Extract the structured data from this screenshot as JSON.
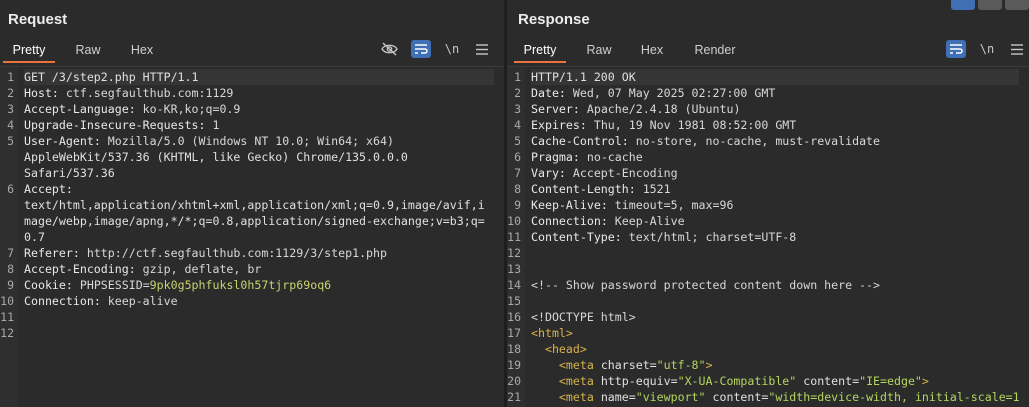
{
  "request": {
    "title": "Request",
    "tabs": [
      {
        "label": "Pretty",
        "active": true
      },
      {
        "label": "Raw",
        "active": false
      },
      {
        "label": "Hex",
        "active": false
      }
    ],
    "toolbar": {
      "wrap_label": "\\n"
    },
    "lines": [
      {
        "n": "1",
        "t": "GET /3/step2.php HTTP/1.1"
      },
      {
        "n": "2",
        "k": "Host",
        "v": "ctf.segfaulthub.com:1129"
      },
      {
        "n": "3",
        "k": "Accept-Language",
        "v": "ko-KR,ko;q=0.9"
      },
      {
        "n": "4",
        "k": "Upgrade-Insecure-Requests",
        "v": "1"
      },
      {
        "n": "5",
        "k": "User-Agent",
        "v": "Mozilla/5.0 (Windows NT 10.0; Win64; x64)"
      },
      {
        "n": "",
        "t": "AppleWebKit/537.36 (KHTML, like Gecko) Chrome/135.0.0.0"
      },
      {
        "n": "",
        "t": "Safari/537.36"
      },
      {
        "n": "6",
        "k": "Accept",
        "v": ""
      },
      {
        "n": "",
        "t": "text/html,application/xhtml+xml,application/xml;q=0.9,image/avif,i"
      },
      {
        "n": "",
        "t": "mage/webp,image/apng,*/*;q=0.8,application/signed-exchange;v=b3;q="
      },
      {
        "n": "",
        "t": "0.7"
      },
      {
        "n": "7",
        "k": "Referer",
        "v": "http://ctf.segfaulthub.com:1129/3/step1.php"
      },
      {
        "n": "8",
        "k": "Accept-Encoding",
        "v": "gzip, deflate, br"
      },
      {
        "n": "9",
        "k": "Cookie",
        "ck": "PHPSESSID",
        "cv": "9pk0g5phfuksl0h57tjrp69oq6"
      },
      {
        "n": "10",
        "k": "Connection",
        "v": "keep-alive"
      },
      {
        "n": "11",
        "t": ""
      },
      {
        "n": "12",
        "t": ""
      }
    ]
  },
  "response": {
    "title": "Response",
    "tabs": [
      {
        "label": "Pretty",
        "active": true
      },
      {
        "label": "Raw",
        "active": false
      },
      {
        "label": "Hex",
        "active": false
      },
      {
        "label": "Render",
        "active": false
      }
    ],
    "toolbar": {
      "wrap_label": "\\n"
    },
    "lines": [
      {
        "n": "1",
        "t": "HTTP/1.1 200 OK"
      },
      {
        "n": "2",
        "k": "Date",
        "v": "Wed, 07 May 2025 02:27:00 GMT"
      },
      {
        "n": "3",
        "k": "Server",
        "v": "Apache/2.4.18 (Ubuntu)"
      },
      {
        "n": "4",
        "k": "Expires",
        "v": "Thu, 19 Nov 1981 08:52:00 GMT"
      },
      {
        "n": "5",
        "k": "Cache-Control",
        "v": "no-store, no-cache, must-revalidate"
      },
      {
        "n": "6",
        "k": "Pragma",
        "v": "no-cache"
      },
      {
        "n": "7",
        "k": "Vary",
        "v": "Accept-Encoding"
      },
      {
        "n": "8",
        "k": "Content-Length",
        "v": "1521"
      },
      {
        "n": "9",
        "k": "Keep-Alive",
        "v": "timeout=5, max=96"
      },
      {
        "n": "10",
        "k": "Connection",
        "v": "Keep-Alive"
      },
      {
        "n": "11",
        "k": "Content-Type",
        "v": "text/html; charset=UTF-8"
      },
      {
        "n": "12",
        "t": ""
      },
      {
        "n": "13",
        "t": ""
      },
      {
        "n": "14",
        "c": "<!-- Show password protected content down here -->"
      },
      {
        "n": "15",
        "t": ""
      },
      {
        "n": "16",
        "c": "<!DOCTYPE html>"
      },
      {
        "n": "17",
        "h": [
          {
            "cls": "tag",
            "s": "<html>"
          }
        ]
      },
      {
        "n": "18",
        "h": [
          {
            "cls": "sp",
            "s": "  "
          },
          {
            "cls": "tag",
            "s": "<head>"
          }
        ]
      },
      {
        "n": "19",
        "h": [
          {
            "cls": "sp",
            "s": "    "
          },
          {
            "cls": "tag",
            "s": "<meta "
          },
          {
            "cls": "attr",
            "s": "charset="
          },
          {
            "cls": "str",
            "s": "\"utf-8\""
          },
          {
            "cls": "tag",
            "s": ">"
          }
        ]
      },
      {
        "n": "20",
        "h": [
          {
            "cls": "sp",
            "s": "    "
          },
          {
            "cls": "tag",
            "s": "<meta "
          },
          {
            "cls": "attr",
            "s": "http-equiv="
          },
          {
            "cls": "str",
            "s": "\"X-UA-Compatible\""
          },
          {
            "cls": "attr",
            "s": " content="
          },
          {
            "cls": "str",
            "s": "\"IE=edge\""
          },
          {
            "cls": "tag",
            "s": ">"
          }
        ]
      },
      {
        "n": "21",
        "h": [
          {
            "cls": "sp",
            "s": "    "
          },
          {
            "cls": "tag",
            "s": "<meta "
          },
          {
            "cls": "attr",
            "s": "name="
          },
          {
            "cls": "str",
            "s": "\"viewport\""
          },
          {
            "cls": "attr",
            "s": " content="
          },
          {
            "cls": "str",
            "s": "\"width=device-width, initial-scale=1"
          }
        ]
      }
    ]
  }
}
